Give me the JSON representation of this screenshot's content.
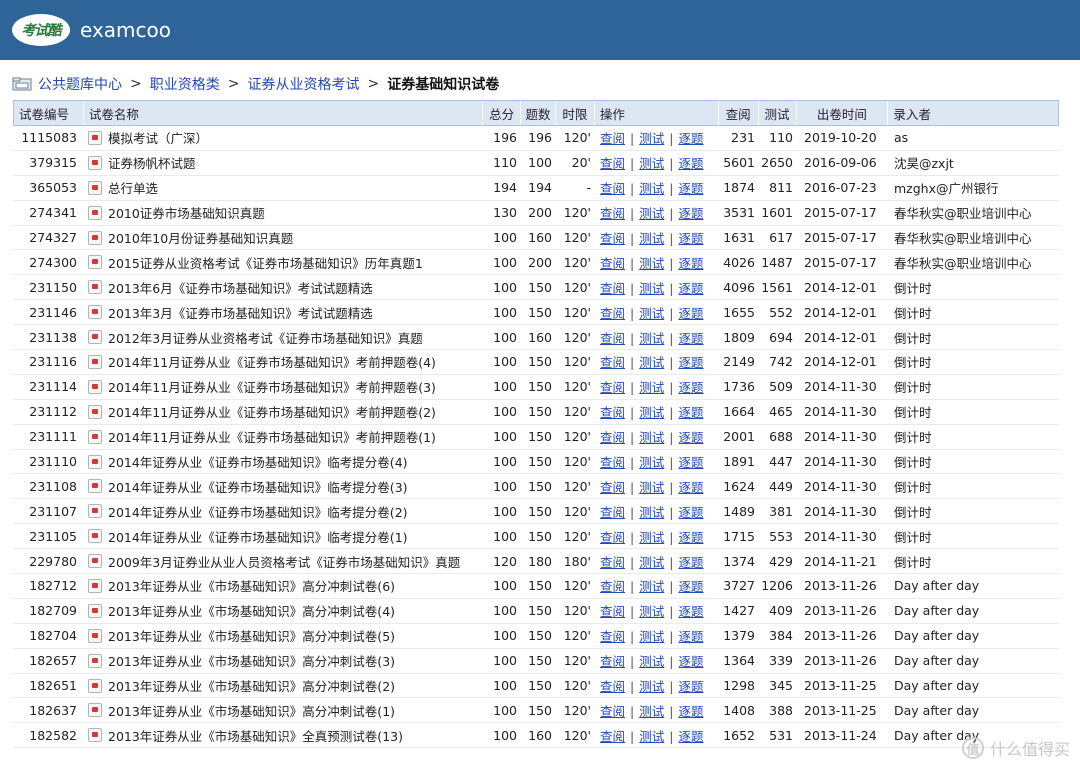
{
  "header": {
    "logo_text": "考试酷",
    "brand": "examcoo"
  },
  "breadcrumb": {
    "items": [
      "公共题库中心",
      "职业资格类",
      "证券从业资格考试"
    ],
    "separator": ">",
    "current": "证券基础知识试卷"
  },
  "table": {
    "headers": {
      "id": "试卷编号",
      "name": "试卷名称",
      "total": "总分",
      "count": "题数",
      "time": "时限",
      "ops": "操作",
      "views": "查阅",
      "tests": "测试",
      "date": "出卷时间",
      "author": "录入者"
    },
    "op_labels": {
      "view": "查阅",
      "test": "测试",
      "each": "逐题",
      "sep": "|"
    },
    "rows": [
      {
        "id": "1115083",
        "name": "模拟考试（广深）",
        "total": "196",
        "count": "196",
        "time": "120'",
        "views": "231",
        "tests": "110",
        "date": "2019-10-20",
        "author": "as"
      },
      {
        "id": "379315",
        "name": "证券杨帆杯试题",
        "total": "110",
        "count": "100",
        "time": "20'",
        "views": "5601",
        "tests": "2650",
        "date": "2016-09-06",
        "author": "沈昊@zxjt"
      },
      {
        "id": "365053",
        "name": "总行单选",
        "total": "194",
        "count": "194",
        "time": "-",
        "views": "1874",
        "tests": "811",
        "date": "2016-07-23",
        "author": "mzghx@广州银行"
      },
      {
        "id": "274341",
        "name": "2010证券市场基础知识真题",
        "total": "130",
        "count": "200",
        "time": "120'",
        "views": "3531",
        "tests": "1601",
        "date": "2015-07-17",
        "author": "春华秋实@职业培训中心"
      },
      {
        "id": "274327",
        "name": "2010年10月份证券基础知识真题",
        "total": "100",
        "count": "160",
        "time": "120'",
        "views": "1631",
        "tests": "617",
        "date": "2015-07-17",
        "author": "春华秋实@职业培训中心"
      },
      {
        "id": "274300",
        "name": "2015证券从业资格考试《证券市场基础知识》历年真题1",
        "total": "100",
        "count": "200",
        "time": "120'",
        "views": "4026",
        "tests": "1487",
        "date": "2015-07-17",
        "author": "春华秋实@职业培训中心"
      },
      {
        "id": "231150",
        "name": "2013年6月《证券市场基础知识》考试试题精选",
        "total": "100",
        "count": "150",
        "time": "120'",
        "views": "4096",
        "tests": "1561",
        "date": "2014-12-01",
        "author": "倒计时"
      },
      {
        "id": "231146",
        "name": "2013年3月《证券市场基础知识》考试试题精选",
        "total": "100",
        "count": "150",
        "time": "120'",
        "views": "1655",
        "tests": "552",
        "date": "2014-12-01",
        "author": "倒计时"
      },
      {
        "id": "231138",
        "name": "2012年3月证券从业资格考试《证券市场基础知识》真题",
        "total": "100",
        "count": "160",
        "time": "120'",
        "views": "1809",
        "tests": "694",
        "date": "2014-12-01",
        "author": "倒计时"
      },
      {
        "id": "231116",
        "name": "2014年11月证券从业《证券市场基础知识》考前押题卷(4)",
        "total": "100",
        "count": "150",
        "time": "120'",
        "views": "2149",
        "tests": "742",
        "date": "2014-12-01",
        "author": "倒计时"
      },
      {
        "id": "231114",
        "name": "2014年11月证券从业《证券市场基础知识》考前押题卷(3)",
        "total": "100",
        "count": "150",
        "time": "120'",
        "views": "1736",
        "tests": "509",
        "date": "2014-11-30",
        "author": "倒计时"
      },
      {
        "id": "231112",
        "name": "2014年11月证券从业《证券市场基础知识》考前押题卷(2)",
        "total": "100",
        "count": "150",
        "time": "120'",
        "views": "1664",
        "tests": "465",
        "date": "2014-11-30",
        "author": "倒计时"
      },
      {
        "id": "231111",
        "name": "2014年11月证券从业《证券市场基础知识》考前押题卷(1)",
        "total": "100",
        "count": "150",
        "time": "120'",
        "views": "2001",
        "tests": "688",
        "date": "2014-11-30",
        "author": "倒计时"
      },
      {
        "id": "231110",
        "name": "2014年证券从业《证券市场基础知识》临考提分卷(4)",
        "total": "100",
        "count": "150",
        "time": "120'",
        "views": "1891",
        "tests": "447",
        "date": "2014-11-30",
        "author": "倒计时"
      },
      {
        "id": "231108",
        "name": "2014年证券从业《证券市场基础知识》临考提分卷(3)",
        "total": "100",
        "count": "150",
        "time": "120'",
        "views": "1624",
        "tests": "449",
        "date": "2014-11-30",
        "author": "倒计时"
      },
      {
        "id": "231107",
        "name": "2014年证券从业《证券市场基础知识》临考提分卷(2)",
        "total": "100",
        "count": "150",
        "time": "120'",
        "views": "1489",
        "tests": "381",
        "date": "2014-11-30",
        "author": "倒计时"
      },
      {
        "id": "231105",
        "name": "2014年证券从业《证券市场基础知识》临考提分卷(1)",
        "total": "100",
        "count": "150",
        "time": "120'",
        "views": "1715",
        "tests": "553",
        "date": "2014-11-30",
        "author": "倒计时"
      },
      {
        "id": "229780",
        "name": "2009年3月证券业从业人员资格考试《证券市场基础知识》真题",
        "total": "120",
        "count": "180",
        "time": "180'",
        "views": "1374",
        "tests": "429",
        "date": "2014-11-21",
        "author": "倒计时"
      },
      {
        "id": "182712",
        "name": "2013年证券从业《市场基础知识》高分冲刺试卷(6)",
        "total": "100",
        "count": "150",
        "time": "120'",
        "views": "3727",
        "tests": "1206",
        "date": "2013-11-26",
        "author": "Day after day"
      },
      {
        "id": "182709",
        "name": "2013年证券从业《市场基础知识》高分冲刺试卷(4)",
        "total": "100",
        "count": "150",
        "time": "120'",
        "views": "1427",
        "tests": "409",
        "date": "2013-11-26",
        "author": "Day after day"
      },
      {
        "id": "182704",
        "name": "2013年证券从业《市场基础知识》高分冲刺试卷(5)",
        "total": "100",
        "count": "150",
        "time": "120'",
        "views": "1379",
        "tests": "384",
        "date": "2013-11-26",
        "author": "Day after day"
      },
      {
        "id": "182657",
        "name": "2013年证券从业《市场基础知识》高分冲刺试卷(3)",
        "total": "100",
        "count": "150",
        "time": "120'",
        "views": "1364",
        "tests": "339",
        "date": "2013-11-26",
        "author": "Day after day"
      },
      {
        "id": "182651",
        "name": "2013年证券从业《市场基础知识》高分冲刺试卷(2)",
        "total": "100",
        "count": "150",
        "time": "120'",
        "views": "1298",
        "tests": "345",
        "date": "2013-11-25",
        "author": "Day after day"
      },
      {
        "id": "182637",
        "name": "2013年证券从业《市场基础知识》高分冲刺试卷(1)",
        "total": "100",
        "count": "150",
        "time": "120'",
        "views": "1408",
        "tests": "388",
        "date": "2013-11-25",
        "author": "Day after day"
      },
      {
        "id": "182582",
        "name": "2013年证券从业《市场基础知识》全真预测试卷(13)",
        "total": "100",
        "count": "160",
        "time": "120'",
        "views": "1652",
        "tests": "531",
        "date": "2013-11-24",
        "author": "Day after day"
      }
    ]
  },
  "watermark": {
    "icon_text": "值",
    "text": "什么值得买"
  }
}
